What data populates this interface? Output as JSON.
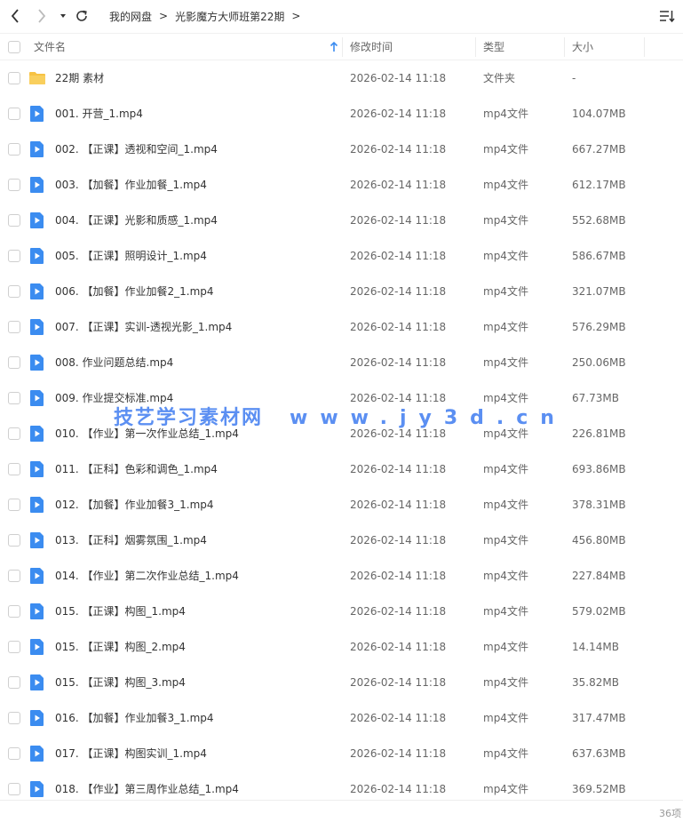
{
  "breadcrumb": [
    "我的网盘",
    "光影魔方大师班第22期"
  ],
  "breadcrumb_separator": ">",
  "columns": {
    "name": "文件名",
    "modified": "修改时间",
    "type": "类型",
    "size": "大小"
  },
  "colors": {
    "folder": "#F7C243",
    "video": "#3B8CF0",
    "watermark": "#3F7CF0"
  },
  "files": [
    {
      "icon": "folder-icon",
      "name": "22期 素材",
      "modified": "2026-02-14 11:18",
      "type": "文件夹",
      "size": "-"
    },
    {
      "icon": "video-file-icon",
      "name": "001. 开营_1.mp4",
      "modified": "2026-02-14 11:18",
      "type": "mp4文件",
      "size": "104.07MB"
    },
    {
      "icon": "video-file-icon",
      "name": "002. 【正课】透视和空间_1.mp4",
      "modified": "2026-02-14 11:18",
      "type": "mp4文件",
      "size": "667.27MB"
    },
    {
      "icon": "video-file-icon",
      "name": "003. 【加餐】作业加餐_1.mp4",
      "modified": "2026-02-14 11:18",
      "type": "mp4文件",
      "size": "612.17MB"
    },
    {
      "icon": "video-file-icon",
      "name": "004. 【正课】光影和质感_1.mp4",
      "modified": "2026-02-14 11:18",
      "type": "mp4文件",
      "size": "552.68MB"
    },
    {
      "icon": "video-file-icon",
      "name": "005. 【正课】照明设计_1.mp4",
      "modified": "2026-02-14 11:18",
      "type": "mp4文件",
      "size": "586.67MB"
    },
    {
      "icon": "video-file-icon",
      "name": "006. 【加餐】作业加餐2_1.mp4",
      "modified": "2026-02-14 11:18",
      "type": "mp4文件",
      "size": "321.07MB"
    },
    {
      "icon": "video-file-icon",
      "name": "007. 【正课】实训-透视光影_1.mp4",
      "modified": "2026-02-14 11:18",
      "type": "mp4文件",
      "size": "576.29MB"
    },
    {
      "icon": "video-file-icon",
      "name": "008. 作业问题总结.mp4",
      "modified": "2026-02-14 11:18",
      "type": "mp4文件",
      "size": "250.06MB"
    },
    {
      "icon": "video-file-icon",
      "name": "009. 作业提交标准.mp4",
      "modified": "2026-02-14 11:18",
      "type": "mp4文件",
      "size": "67.73MB"
    },
    {
      "icon": "video-file-icon",
      "name": "010. 【作业】第一次作业总结_1.mp4",
      "modified": "2026-02-14 11:18",
      "type": "mp4文件",
      "size": "226.81MB"
    },
    {
      "icon": "video-file-icon",
      "name": "011. 【正科】色彩和调色_1.mp4",
      "modified": "2026-02-14 11:18",
      "type": "mp4文件",
      "size": "693.86MB"
    },
    {
      "icon": "video-file-icon",
      "name": "012. 【加餐】作业加餐3_1.mp4",
      "modified": "2026-02-14 11:18",
      "type": "mp4文件",
      "size": "378.31MB"
    },
    {
      "icon": "video-file-icon",
      "name": "013. 【正科】烟雾氛围_1.mp4",
      "modified": "2026-02-14 11:18",
      "type": "mp4文件",
      "size": "456.80MB"
    },
    {
      "icon": "video-file-icon",
      "name": "014. 【作业】第二次作业总结_1.mp4",
      "modified": "2026-02-14 11:18",
      "type": "mp4文件",
      "size": "227.84MB"
    },
    {
      "icon": "video-file-icon",
      "name": "015. 【正课】构图_1.mp4",
      "modified": "2026-02-14 11:18",
      "type": "mp4文件",
      "size": "579.02MB"
    },
    {
      "icon": "video-file-icon",
      "name": "015. 【正课】构图_2.mp4",
      "modified": "2026-02-14 11:18",
      "type": "mp4文件",
      "size": "14.14MB"
    },
    {
      "icon": "video-file-icon",
      "name": "015. 【正课】构图_3.mp4",
      "modified": "2026-02-14 11:18",
      "type": "mp4文件",
      "size": "35.82MB"
    },
    {
      "icon": "video-file-icon",
      "name": "016. 【加餐】作业加餐3_1.mp4",
      "modified": "2026-02-14 11:18",
      "type": "mp4文件",
      "size": "317.47MB"
    },
    {
      "icon": "video-file-icon",
      "name": "017. 【正课】构图实训_1.mp4",
      "modified": "2026-02-14 11:18",
      "type": "mp4文件",
      "size": "637.63MB"
    },
    {
      "icon": "video-file-icon",
      "name": "018. 【作业】第三周作业总结_1.mp4",
      "modified": "2026-02-14 11:18",
      "type": "mp4文件",
      "size": "369.52MB"
    }
  ],
  "watermark": {
    "site": "技艺学习素材网",
    "url": "www.jy3d.cn"
  },
  "footer": {
    "count": "36项"
  }
}
